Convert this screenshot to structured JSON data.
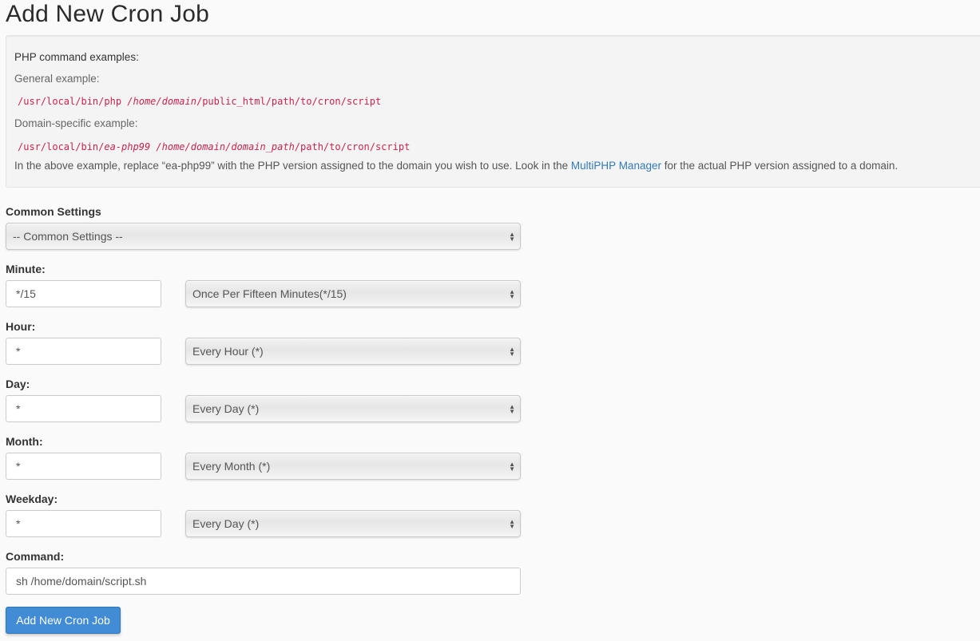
{
  "page": {
    "title": "Add New Cron Job"
  },
  "examples": {
    "heading": "PHP command examples:",
    "general_label": "General example:",
    "general_cmd": {
      "part1": "/usr/local/bin/php ",
      "italic1": "/home/domain",
      "part2": "/public_html/path/to/cron/script"
    },
    "domain_label": "Domain-specific example:",
    "domain_cmd": {
      "part1": "/usr/local/bin/",
      "italic1": "ea-php99 /home/domain/domain_path",
      "part2": "/path/to/cron/script"
    },
    "note_before": "In the above example, replace “ea-php99” with the PHP version assigned to the domain you wish to use. Look in the ",
    "note_link": "MultiPHP Manager",
    "note_after": " for the actual PHP version assigned to a domain."
  },
  "form": {
    "common_settings": {
      "label": "Common Settings",
      "selected": "-- Common Settings --"
    },
    "minute": {
      "label": "Minute:",
      "value": "*/15",
      "selected": "Once Per Fifteen Minutes(*/15)"
    },
    "hour": {
      "label": "Hour:",
      "value": "*",
      "selected": "Every Hour (*)"
    },
    "day": {
      "label": "Day:",
      "value": "*",
      "selected": "Every Day (*)"
    },
    "month": {
      "label": "Month:",
      "value": "*",
      "selected": "Every Month (*)"
    },
    "weekday": {
      "label": "Weekday:",
      "value": "*",
      "selected": "Every Day (*)"
    },
    "command": {
      "label": "Command:",
      "value": "sh /home/domain/script.sh"
    },
    "submit_label": "Add New Cron Job"
  },
  "colors": {
    "code": "#c7254e",
    "link": "#337ab7",
    "button": "#428bd5"
  }
}
